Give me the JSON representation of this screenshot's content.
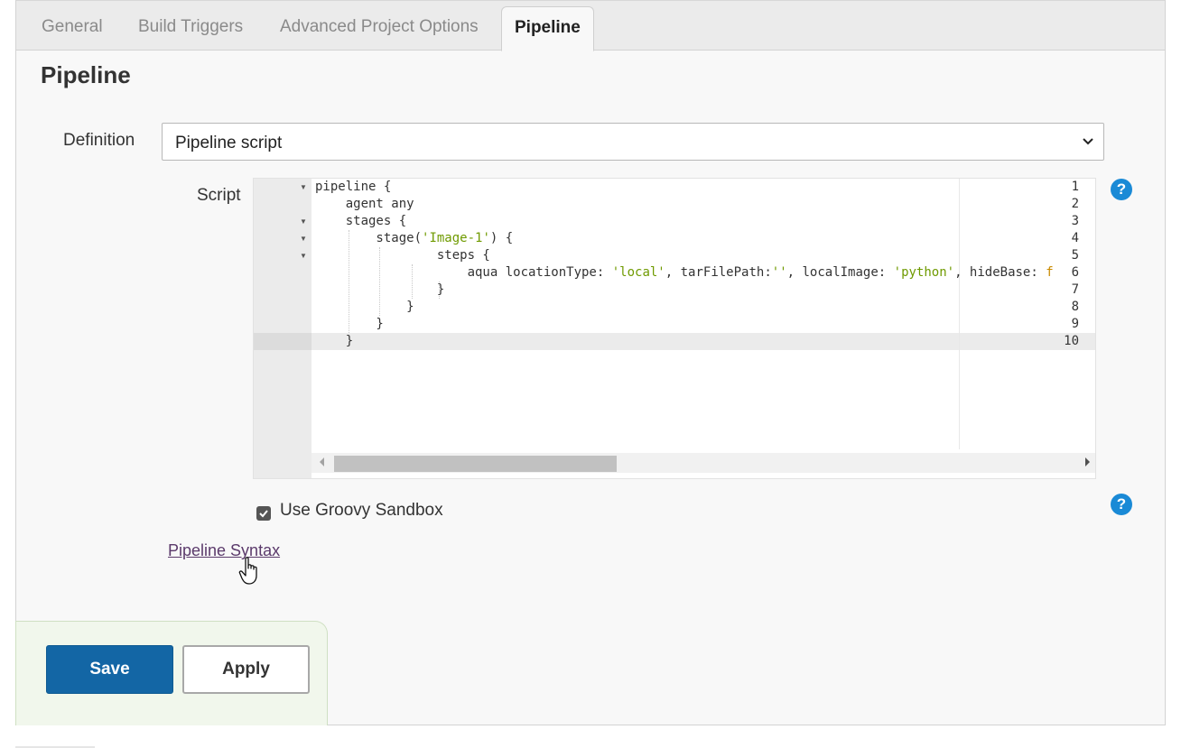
{
  "tabs": [
    {
      "label": "General",
      "active": false
    },
    {
      "label": "Build Triggers",
      "active": false
    },
    {
      "label": "Advanced Project Options",
      "active": false
    },
    {
      "label": "Pipeline",
      "active": true
    }
  ],
  "section": {
    "title": "Pipeline"
  },
  "definition": {
    "label": "Definition",
    "selected": "Pipeline script"
  },
  "script": {
    "label": "Script",
    "line_numbers": [
      "1",
      "2",
      "3",
      "4",
      "5",
      "6",
      "7",
      "8",
      "9",
      "10"
    ],
    "lines": [
      [
        "pipeline {"
      ],
      [
        "    agent any"
      ],
      [
        "    stages {"
      ],
      [
        "        stage(",
        "'Image-1'",
        ") {"
      ],
      [
        "                steps {"
      ],
      [
        "                    aqua locationType: ",
        "'local'",
        ", tarFilePath:",
        "''",
        ", localImage: ",
        "'python'",
        ", hideBase: ",
        "f"
      ],
      [
        "                }"
      ],
      [
        "            }"
      ],
      [
        "        }"
      ],
      [
        "    }"
      ]
    ],
    "active_line": "10"
  },
  "sandbox": {
    "label": "Use Groovy Sandbox",
    "checked": true
  },
  "links": {
    "pipeline_syntax": "Pipeline Syntax"
  },
  "help": {
    "glyph": "?"
  },
  "buttons": {
    "save": "Save",
    "apply": "Apply"
  },
  "colors": {
    "save_button": "#1366a5",
    "help_icon": "#1a8ad6",
    "string_literal": "#6f9a00",
    "link": "#5b3a6b",
    "bottom_bar": "#f1f7ec"
  }
}
